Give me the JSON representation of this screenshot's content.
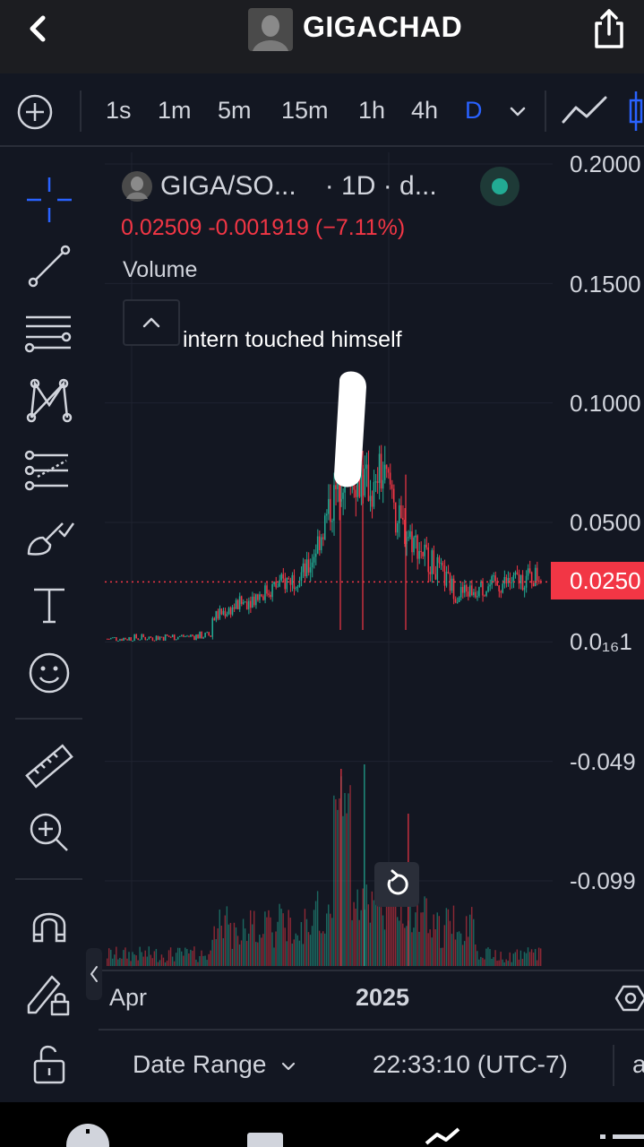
{
  "header": {
    "back_icon": "chevron-left-icon",
    "title": "GIGACHAD",
    "share_icon": "share-icon"
  },
  "toolbar": {
    "add_icon": "plus-circle-icon",
    "timeframes": [
      "1s",
      "1m",
      "5m",
      "15m",
      "1h",
      "4h",
      "D"
    ],
    "active_timeframe": "D",
    "dropdown_icon": "chevron-down-icon",
    "chart_type_icons": [
      "line-chart-icon",
      "candles-icon"
    ],
    "accent_color": "#2962ff"
  },
  "tools": [
    "crosshair-icon",
    "trendline-icon",
    "fib-lines-icon",
    "pattern-icon",
    "projection-icon",
    "brush-icon",
    "text-icon",
    "emoji-icon",
    "ruler-icon",
    "zoom-in-icon",
    "magnet-icon",
    "lock-drawing-icon",
    "unlock-icon"
  ],
  "legend": {
    "pair": "GIGA/SO...",
    "interval": "· 1D · d...",
    "last": "0.02509",
    "change": "-0.001919",
    "change_pct": "(−7.11%)",
    "volume_label": "Volume",
    "up_color": "#22ab94",
    "down_color": "#f23645"
  },
  "annotation": "intern touched himself",
  "price_axis": {
    "labels": [
      "0.2000",
      "0.1500",
      "0.1000",
      "0.0500",
      "0.0₁₆1",
      "-0.049",
      "-0.099"
    ],
    "last_price_label": "0.0250"
  },
  "time_axis": {
    "labels": [
      "Apr",
      "2025"
    ]
  },
  "bottom": {
    "date_range": "Date Range",
    "time": "22:33:10 (UTC-7)",
    "adj": "a"
  },
  "chart_data": {
    "type": "candlestick",
    "ylim": [
      -0.11,
      0.2
    ],
    "last_price": 0.02509,
    "x_ticks": [
      "Apr",
      "2025"
    ],
    "series": [
      {
        "name": "GIGA/SOL",
        "kind": "price"
      },
      {
        "name": "Volume",
        "kind": "volume"
      }
    ]
  }
}
